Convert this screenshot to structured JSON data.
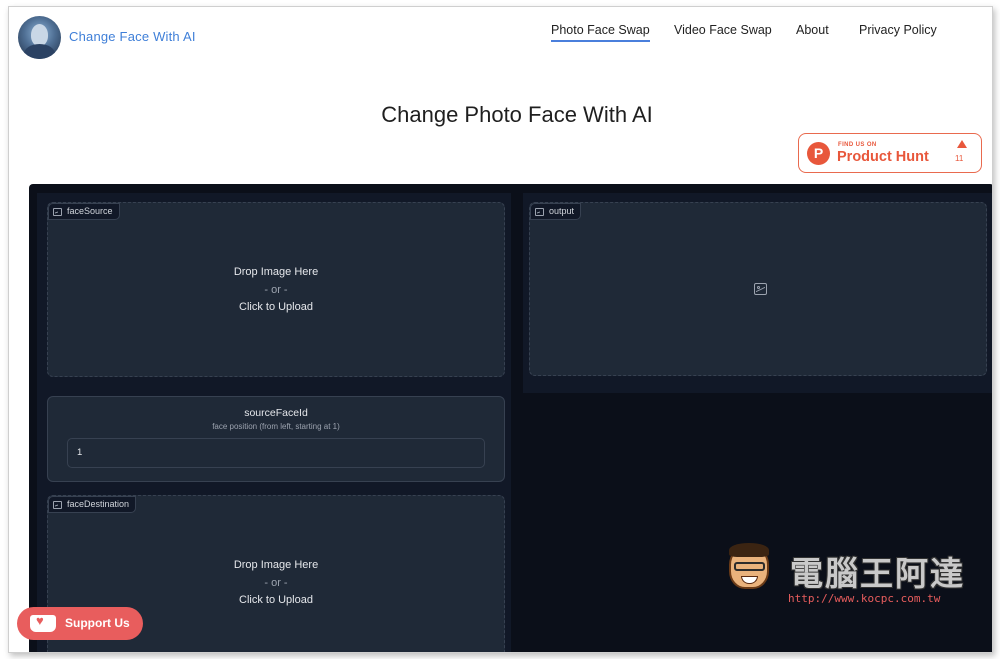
{
  "header": {
    "brand": "Change Face With AI",
    "nav": [
      "Photo Face Swap",
      "Video Face Swap",
      "About",
      "Privacy Policy"
    ],
    "active_nav": "Photo Face Swap"
  },
  "page_title": "Change Photo Face With AI",
  "product_hunt": {
    "small": "FIND US ON",
    "big": "Product Hunt",
    "count": "11"
  },
  "face_source": {
    "tag": "faceSource",
    "drop": "Drop Image Here",
    "or": "- or -",
    "click": "Click to Upload"
  },
  "output": {
    "tag": "output"
  },
  "source_face_id": {
    "label": "sourceFaceId",
    "info": "face position (from left, starting at 1)",
    "value": "1"
  },
  "face_destination": {
    "tag": "faceDestination",
    "drop": "Drop Image Here",
    "or": "- or -",
    "click": "Click to Upload"
  },
  "support": {
    "label": "Support Us"
  },
  "watermark": {
    "text": "電腦王阿達",
    "url": "http://www.kocpc.com.tw"
  },
  "colors": {
    "accent": "#4a7fdc",
    "ph": "#e8573b",
    "app_bg": "#0b0f19",
    "panel": "#1f2937",
    "support": "#e85d5d"
  },
  "icons": [
    "image-icon",
    "upload-icon",
    "product-hunt-icon",
    "ko-fi-cup-icon"
  ]
}
